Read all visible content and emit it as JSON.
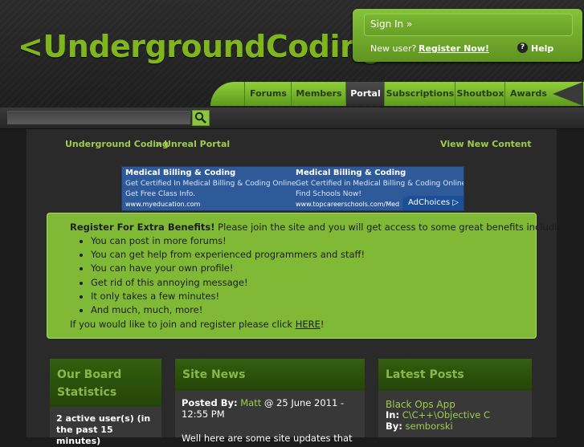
{
  "header": {
    "logo_text": "<UndergroundCoding",
    "signin_label": "Sign In »",
    "new_user_label": "New user?",
    "register_label": "Register Now!",
    "help_label": "Help",
    "help_icon": "?"
  },
  "nav": {
    "tabs": [
      {
        "label": "Forums"
      },
      {
        "label": "Members"
      },
      {
        "label": "Portal"
      },
      {
        "label": "Subscriptions"
      },
      {
        "label": "Shoutbox"
      },
      {
        "label": "Awards"
      }
    ],
    "active_tab": "Portal"
  },
  "search": {
    "value": "",
    "placeholder": ""
  },
  "breadcrumb": {
    "home": "Underground Coding",
    "separator": ">",
    "current": "Unreal Portal",
    "view_new": "View New Content"
  },
  "ad": {
    "left": {
      "title": "Medical Billing & Coding",
      "line1": "Get Certified In Medical Billing & Coding Online.",
      "line2": "Get Free Class Info.",
      "url": "www.myeducation.com"
    },
    "right": {
      "title": "Medical Billing & Coding",
      "line1": "Get Certified in Medical Billing & Coding Online.",
      "line2": "Find Schools Now!",
      "url": "www.topcareerschools.com/Med"
    },
    "adchoices": "AdChoices ▷"
  },
  "register_notice": {
    "title": "Register For Extra Benefits!",
    "intro": " Please join the site and you will get access to some great benefits including:",
    "benefits": [
      "You can post in more forums!",
      "You can get help from experienced programmers and staff!",
      "You can have your own profile!",
      "Get rid of this annoying message!",
      "It only takes a few minutes!",
      "And much, much, more!"
    ],
    "outro_before": "If you would like to join and register please click ",
    "outro_link": "HERE",
    "outro_after": "!"
  },
  "panels": {
    "stats": {
      "title": "Our Board Statistics",
      "active_users": "2 active user(s) (in the past 15 minutes)"
    },
    "news": {
      "title": "Site News",
      "posted_by_label": "Posted By:",
      "author": "Matt",
      "date": " @ 25 June 2011 - 12:55 PM",
      "text": "Well here are some site updates that"
    },
    "latest": {
      "title": "Latest Posts",
      "post_title": "Black Ops App",
      "in_label": "In:",
      "forum": "C\\C++\\Objective C",
      "by_label": "By:",
      "author": "semborski"
    }
  },
  "colors": {
    "accent": "#80b935",
    "link": "#9ecd4c",
    "dark_panel": "#2a2a2a"
  }
}
